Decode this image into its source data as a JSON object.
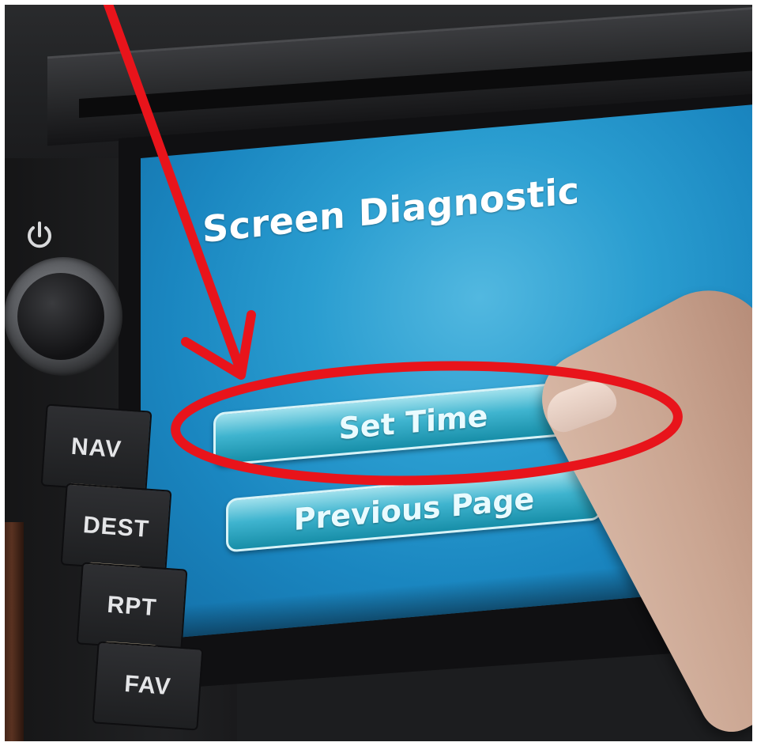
{
  "screen": {
    "title": "Screen Diagnostic",
    "buttons": [
      {
        "label": "Set Time"
      },
      {
        "label": "Previous Page"
      }
    ]
  },
  "side_buttons": [
    "NAV",
    "DEST",
    "RPT",
    "FAV"
  ],
  "annotation": {
    "color": "#e8141b",
    "highlight": "Set Time"
  },
  "colors": {
    "screen": "#1f8fc6",
    "button": "#3fb4cf",
    "bezel": "#1f2022"
  },
  "icons": {
    "power": "power-icon"
  }
}
